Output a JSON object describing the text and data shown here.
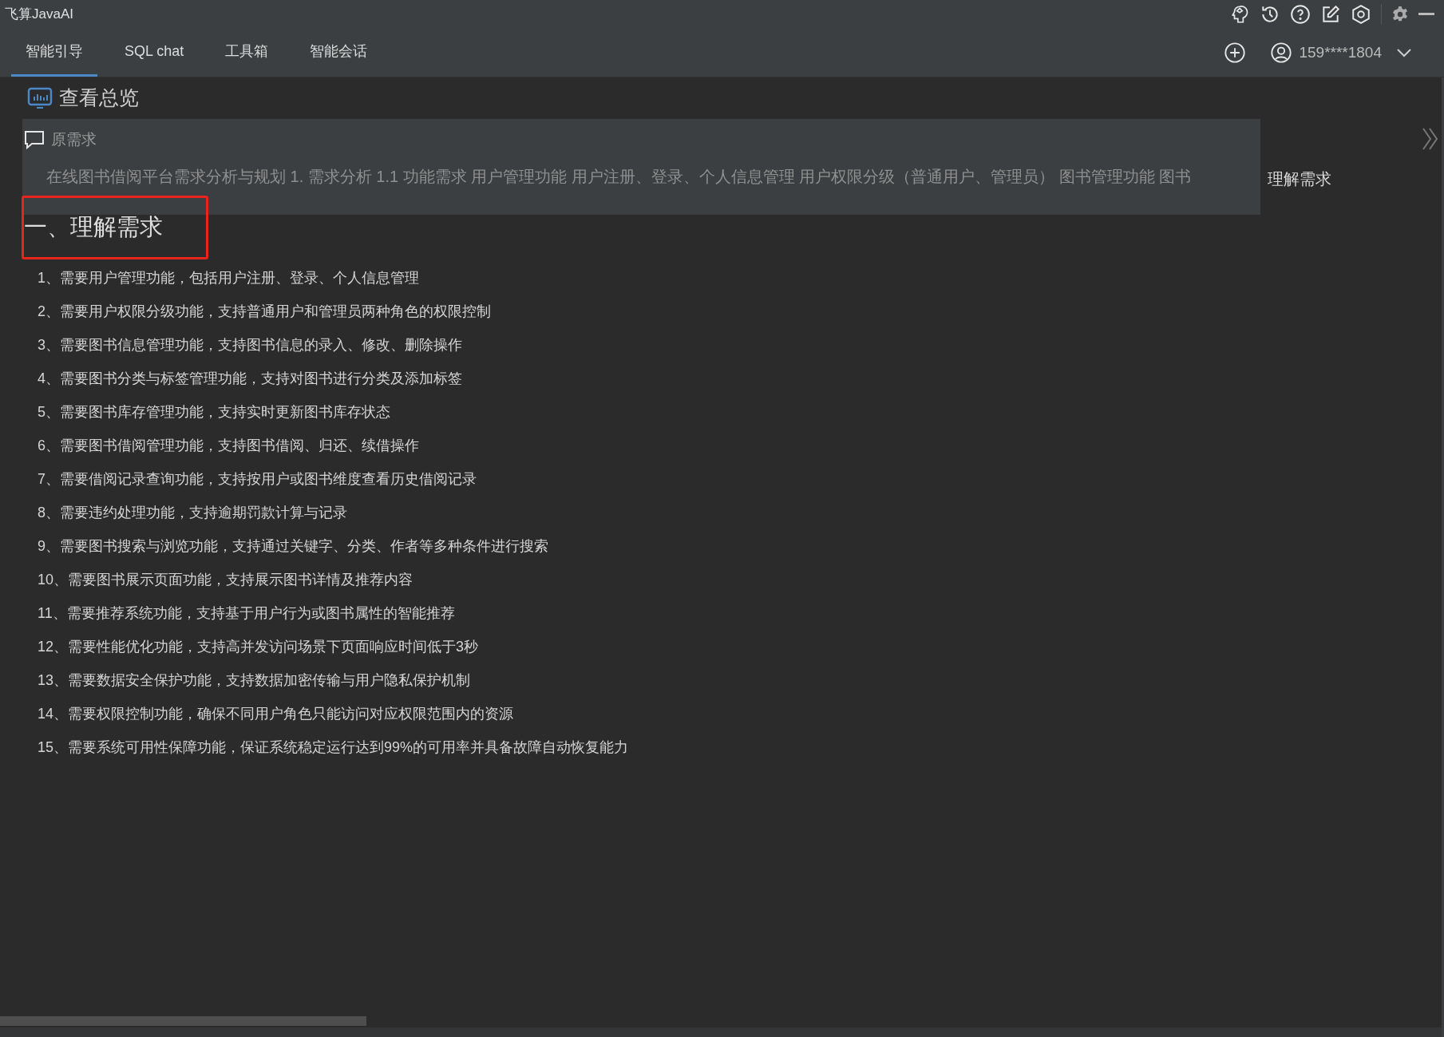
{
  "window": {
    "title": "飞算JavaAI"
  },
  "tabs": [
    {
      "label": "智能引导",
      "selected": true
    },
    {
      "label": "SQL chat",
      "selected": false
    },
    {
      "label": "工具箱",
      "selected": false
    },
    {
      "label": "智能会话",
      "selected": false
    }
  ],
  "account": {
    "user": "159****1804"
  },
  "overview": {
    "title": "查看总览"
  },
  "original_requirement": {
    "label": "原需求",
    "text": "在线图书借阅平台需求分析与规划 1. 需求分析 1.1 功能需求 用户管理功能 用户注册、登录、个人信息管理 用户权限分级（普通用户、管理员） 图书管理功能 图书",
    "side_label": "理解需求"
  },
  "section": {
    "heading": "一、理解需求",
    "highlighted": true,
    "items": [
      "1、需要用户管理功能，包括用户注册、登录、个人信息管理",
      "2、需要用户权限分级功能，支持普通用户和管理员两种角色的权限控制",
      "3、需要图书信息管理功能，支持图书信息的录入、修改、删除操作",
      "4、需要图书分类与标签管理功能，支持对图书进行分类及添加标签",
      "5、需要图书库存管理功能，支持实时更新图书库存状态",
      "6、需要图书借阅管理功能，支持图书借阅、归还、续借操作",
      "7、需要借阅记录查询功能，支持按用户或图书维度查看历史借阅记录",
      "8、需要违约处理功能，支持逾期罚款计算与记录",
      "9、需要图书搜索与浏览功能，支持通过关键字、分类、作者等多种条件进行搜索",
      "10、需要图书展示页面功能，支持展示图书详情及推荐内容",
      "11、需要推荐系统功能，支持基于用户行为或图书属性的智能推荐",
      "12、需要性能优化功能，支持高并发访问场景下页面响应时间低于3秒",
      "13、需要数据安全保护功能，支持数据加密传输与用户隐私保护机制",
      "14、需要权限控制功能，确保不同用户角色只能访问对应权限范围内的资源",
      "15、需要系统可用性保障功能，保证系统稳定运行达到99%的可用率并具备故障自动恢复能力"
    ]
  }
}
